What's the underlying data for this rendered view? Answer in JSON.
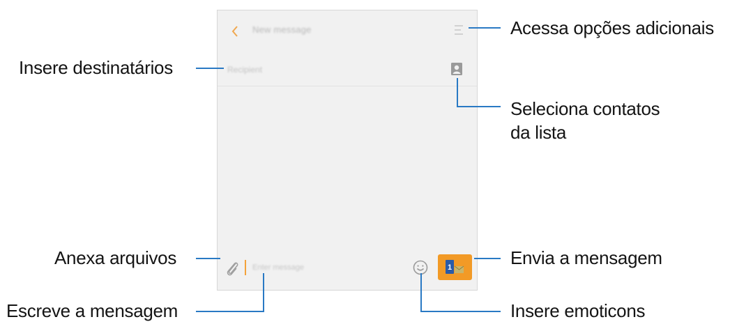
{
  "app": {
    "title": "New message",
    "recipient_placeholder": "Recipient",
    "message_placeholder": "Enter message"
  },
  "icons": {
    "back": "chevron-left-icon",
    "menu": "more-options-icon",
    "contact": "contact-picker-icon",
    "attach": "paperclip-icon",
    "emoji": "smiley-icon",
    "send": "send-sim-icon"
  },
  "colors": {
    "accent": "#f29a26",
    "callout_line": "#2979c4"
  },
  "callouts": {
    "more_options": "Acessa opções adicionais",
    "recipients": "Insere destinatários",
    "contacts_line1": "Seleciona contatos",
    "contacts_line2": "da lista",
    "attach": "Anexa arquivos",
    "send": "Envia a mensagem",
    "write": "Escreve a mensagem",
    "emoticons": "Insere emoticons"
  }
}
